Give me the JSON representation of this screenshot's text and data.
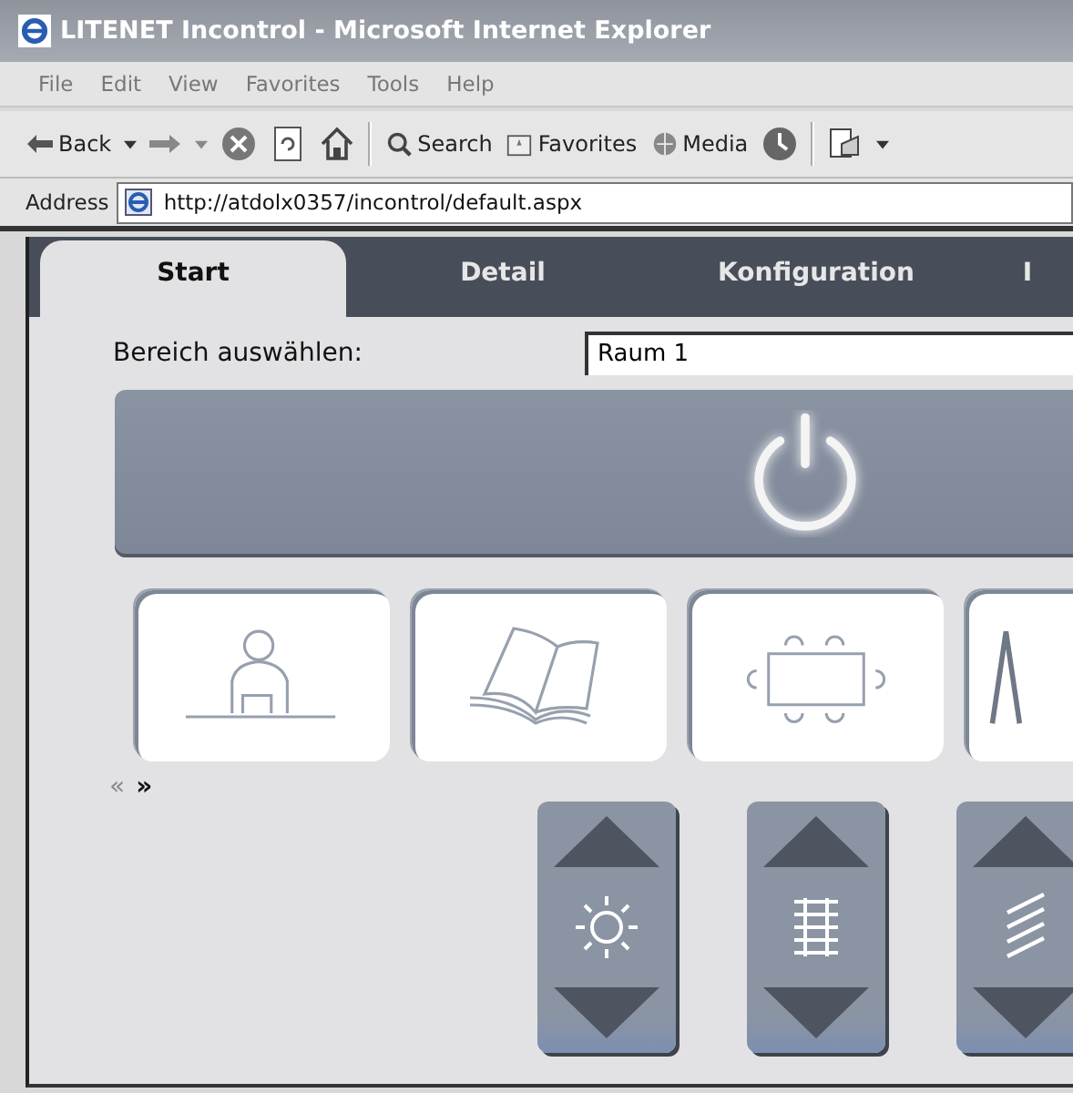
{
  "window": {
    "title": "LITENET Incontrol - Microsoft Internet Explorer"
  },
  "menu": [
    "File",
    "Edit",
    "View",
    "Favorites",
    "Tools",
    "Help"
  ],
  "toolbar": {
    "back": "Back",
    "search": "Search",
    "favorites": "Favorites",
    "media": "Media"
  },
  "address": {
    "label": "Address",
    "url": "http://atdolx0357/incontrol/default.aspx"
  },
  "tabs": [
    {
      "label": "Start",
      "selected": true
    },
    {
      "label": "Detail",
      "selected": false
    },
    {
      "label": "Konfiguration",
      "selected": false
    },
    {
      "label": "I",
      "selected": false
    }
  ],
  "area": {
    "label": "Bereich auswählen:",
    "value": "Raum 1"
  },
  "scenes": [
    {
      "kind": "desk"
    },
    {
      "kind": "book"
    },
    {
      "kind": "table"
    },
    {
      "kind": "easel"
    }
  ],
  "pager": [
    {
      "label": "«",
      "disabled": true
    },
    {
      "label": "»",
      "disabled": false
    }
  ],
  "controls": [
    {
      "kind": "light"
    },
    {
      "kind": "blind"
    },
    {
      "kind": "louver"
    }
  ]
}
